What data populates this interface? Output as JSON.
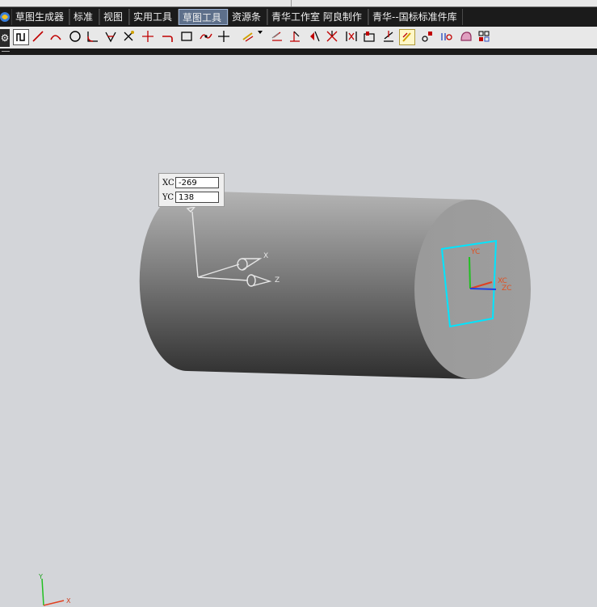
{
  "tabs": [
    {
      "label": "草图生成器",
      "active": false
    },
    {
      "label": "标准",
      "active": false
    },
    {
      "label": "视图",
      "active": false
    },
    {
      "label": "实用工具",
      "active": false
    },
    {
      "label": "草图工具",
      "active": true
    },
    {
      "label": "资源条",
      "active": false
    },
    {
      "label": "青华工作室 阿良制作",
      "active": false
    },
    {
      "label": "青华--国标标准件库",
      "active": false
    }
  ],
  "toolbar_icons": [
    "profile-icon",
    "line-icon",
    "arc-icon",
    "circle-icon",
    "fillet-icon",
    "chamfer-icon",
    "trim-icon",
    "extend-icon",
    "corner-icon",
    "rectangle-icon",
    "studio-spline-icon",
    "point-icon",
    "derived-line-icon",
    "offset-curve-icon",
    "pattern-curve-icon",
    "mirror-curve-icon",
    "add-existing-curve-icon",
    "intersection-curve-icon",
    "project-curve-icon",
    "quick-trim-icon",
    "make-corner-icon",
    "constraints-icon",
    "auto-constraint-icon",
    "show-constraints-icon",
    "convert-reference-icon",
    "alternate-solution-icon",
    "inferred-constraints-icon"
  ],
  "coord_input": {
    "xc_label": "XC",
    "xc_value": "-269",
    "yc_label": "YC",
    "yc_value": "138"
  },
  "triad_labels": {
    "wcs_x": "X",
    "wcs_z": "Z",
    "sketch_yc": "YC",
    "sketch_xc": "XC",
    "sketch_zc": "ZC",
    "corner_y": "Y",
    "corner_x": "X"
  },
  "colors": {
    "background": "#d3d5d9",
    "tabbar": "#1b1b1b",
    "active_tab": "#5d6f8a",
    "sketch_rectangle": "#00e5ff",
    "axis_x": "#e04020",
    "axis_y": "#20c020",
    "axis_z": "#2040e0"
  }
}
